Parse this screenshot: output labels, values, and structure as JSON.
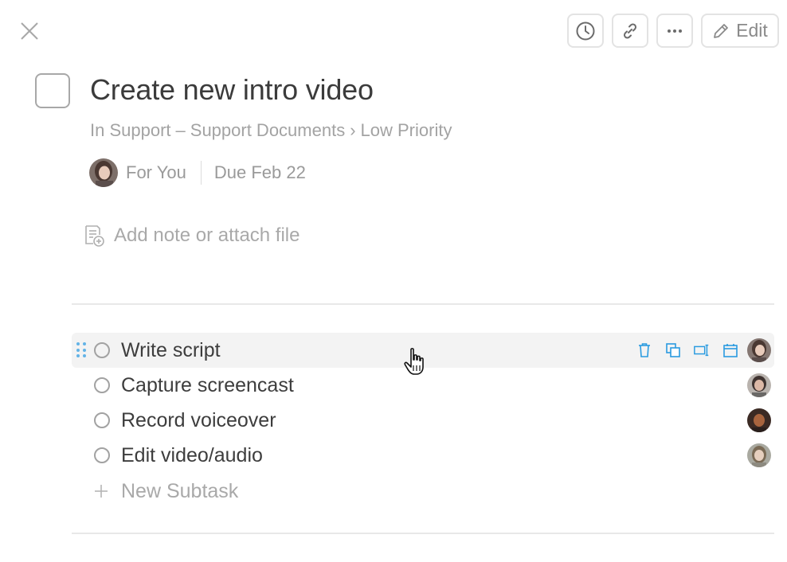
{
  "header": {
    "close_icon": "close-icon",
    "toolbar": [
      {
        "name": "history-button",
        "icon": "clock-icon"
      },
      {
        "name": "copy-link-button",
        "icon": "link-icon"
      },
      {
        "name": "more-button",
        "icon": "ellipsis-icon"
      },
      {
        "name": "edit-button",
        "icon": "pencil-icon",
        "label": "Edit"
      }
    ]
  },
  "task": {
    "title": "Create new intro video",
    "breadcrumb": {
      "prefix": "In Support",
      "dash": "–",
      "project": "Support Documents",
      "arrow": "›",
      "section": "Low Priority"
    },
    "assignee": "For You",
    "due": "Due Feb 22",
    "note_placeholder": "Add note or attach file"
  },
  "subtasks": [
    {
      "label": "Write script",
      "hovered": true,
      "actions": [
        "trash-icon",
        "duplicate-icon",
        "convert-icon",
        "calendar-icon"
      ]
    },
    {
      "label": "Capture screencast"
    },
    {
      "label": "Record voiceover"
    },
    {
      "label": "Edit video/audio"
    }
  ],
  "new_subtask_label": "New Subtask",
  "colors": {
    "accent": "#2a9be0",
    "text": "#3b3b3b",
    "muted": "#a3a3a3",
    "divider": "#e8e8e8"
  }
}
